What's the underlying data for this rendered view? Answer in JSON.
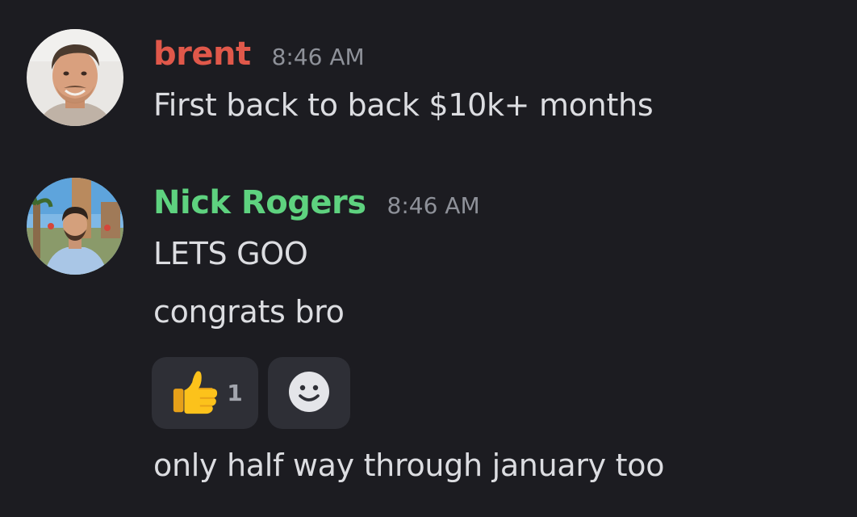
{
  "colors": {
    "background": "#1c1c21",
    "brent_name": "#e0584a",
    "nick_name": "#5ed27f",
    "timestamp": "#8e9199",
    "text": "#dcdde1",
    "reaction_bg": "#2e2f36"
  },
  "messages": [
    {
      "author": "brent",
      "timestamp": "8:46 AM",
      "avatar_icon": "avatar-photo-brent",
      "lines": [
        "First back to back $10k+ months"
      ]
    },
    {
      "author": "Nick Rogers",
      "timestamp": "8:46 AM",
      "avatar_icon": "avatar-photo-nick",
      "lines": [
        "LETS GOO",
        "congrats bro",
        "only half way through january too"
      ],
      "reactions": [
        {
          "emoji_icon": "thumbs-up-emoji",
          "count": "1"
        },
        {
          "emoji_icon": "add-reaction-smile-icon",
          "count": ""
        }
      ]
    }
  ]
}
